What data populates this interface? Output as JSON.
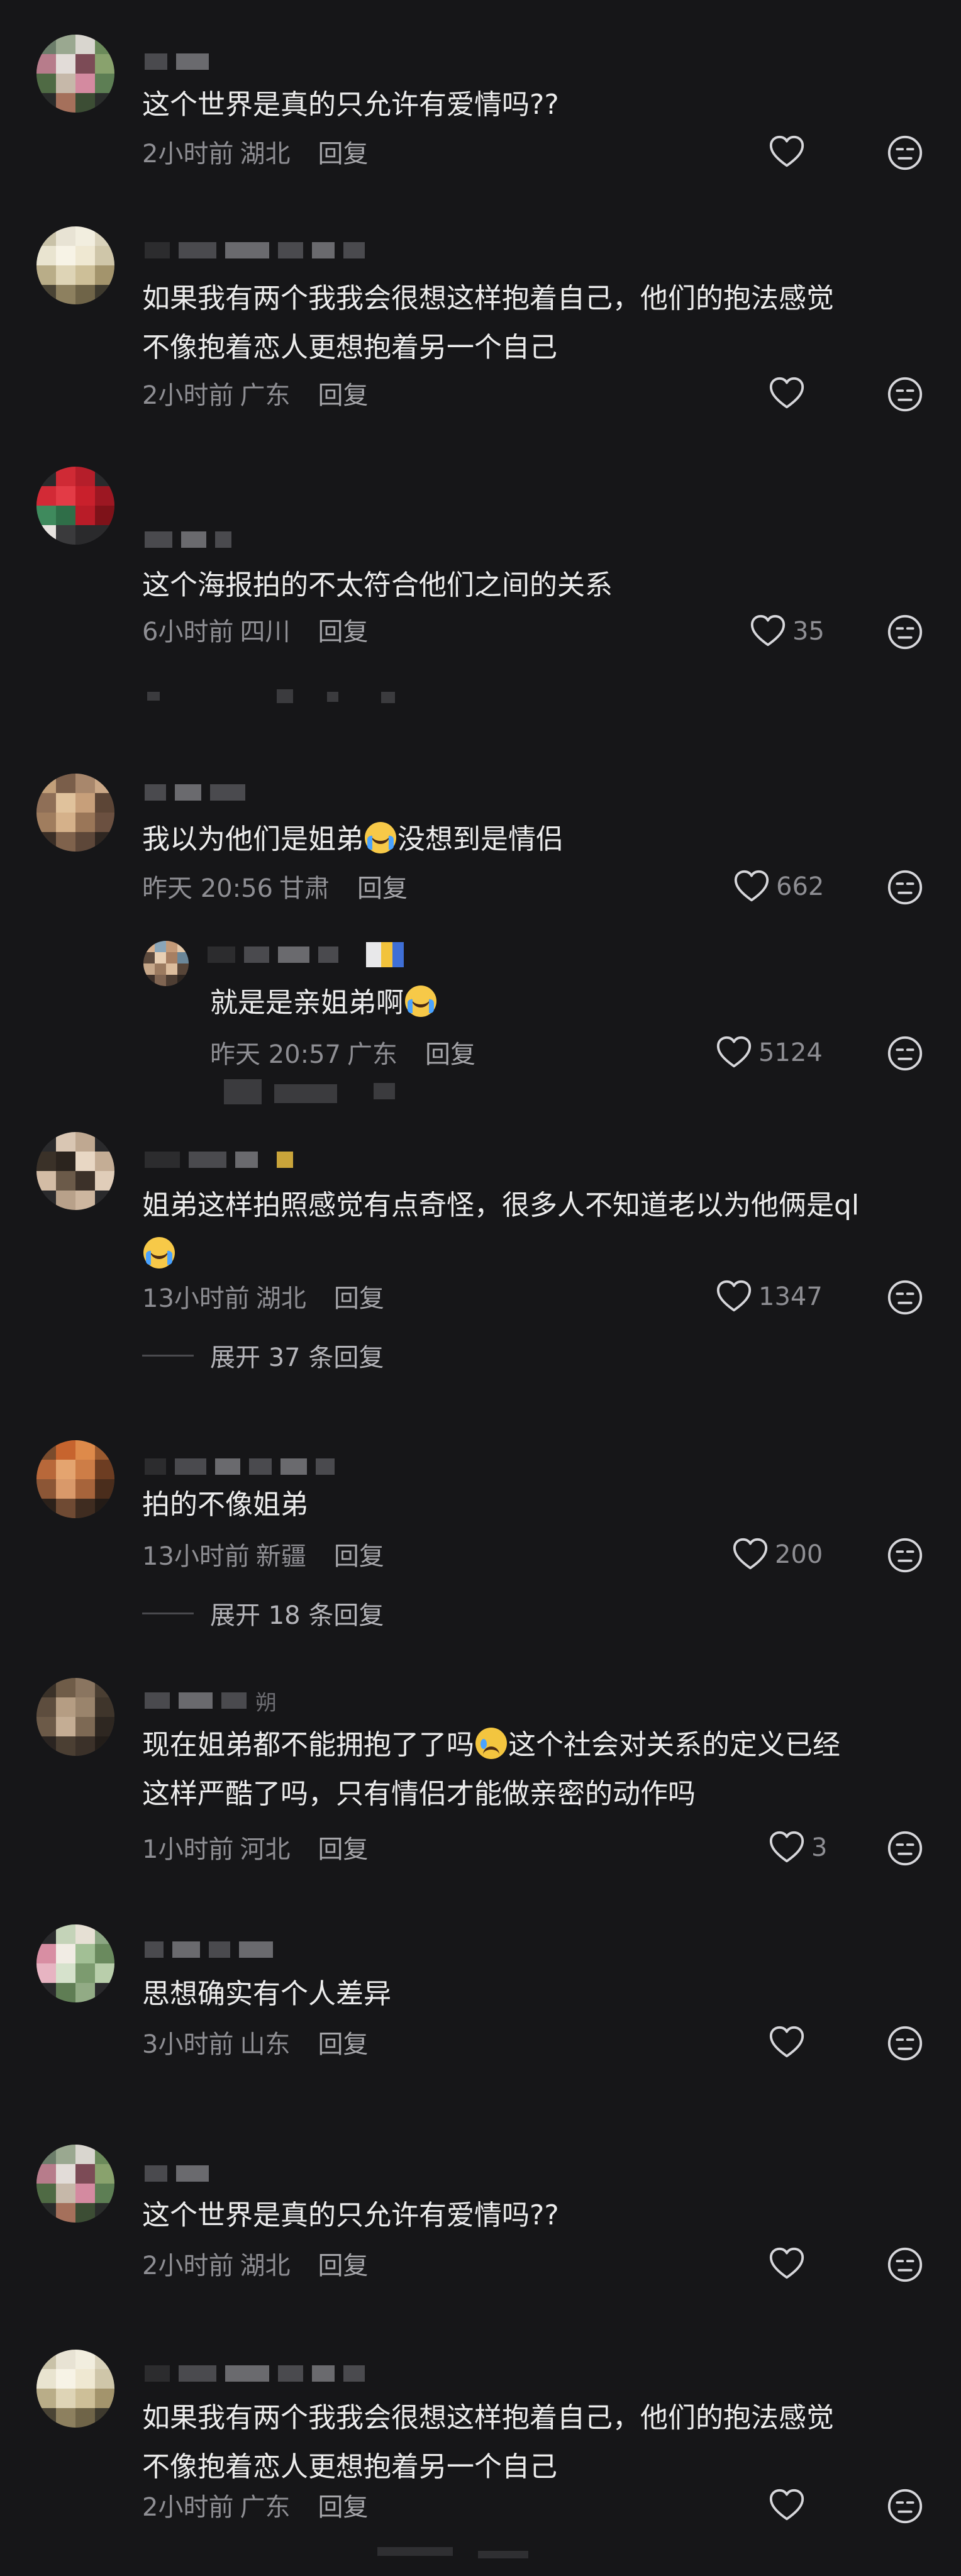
{
  "comments": [
    {
      "text": "这个世界是真的只允许有爱情吗??",
      "time": "2小时前",
      "location": "湖北",
      "reply": "回复",
      "likes": ""
    },
    {
      "text": "如果我有两个我我会很想这样抱着自己，他们的抱法感觉\n不像抱着恋人更想抱着另一个自己",
      "time": "2小时前",
      "location": "广东",
      "reply": "回复",
      "likes": ""
    },
    {
      "text": "这个海报拍的不太符合他们之间的关系",
      "time": "6小时前",
      "location": "四川",
      "reply": "回复",
      "likes": "35"
    },
    {
      "text_a": "我以为他们是姐弟",
      "text_b": "没想到是情侣",
      "time": "昨天 20:56",
      "location": "甘肃",
      "reply": "回复",
      "likes": "662",
      "sub_reply": {
        "text": "就是是亲姐弟啊",
        "time": "昨天 20:57",
        "location": "广东",
        "reply": "回复",
        "likes": "5124"
      }
    },
    {
      "text": "姐弟这样拍照感觉有点奇怪，很多人不知道老以为他俩是ql",
      "time": "13小时前",
      "location": "湖北",
      "reply": "回复",
      "likes": "1347",
      "expand": "展开 37 条回复"
    },
    {
      "text": "拍的不像姐弟",
      "time": "13小时前",
      "location": "新疆",
      "reply": "回复",
      "likes": "200",
      "expand": "展开 18 条回复"
    },
    {
      "text_a": "现在姐弟都不能拥抱了了吗",
      "text_b": "这个社会对关系的定义已经\n这样严酷了吗，只有情侣才能做亲密的动作吗",
      "username_tail": "朔",
      "time": "1小时前",
      "location": "河北",
      "reply": "回复",
      "likes": "3"
    },
    {
      "text": "思想确实有个人差异",
      "time": "3小时前",
      "location": "山东",
      "reply": "回复",
      "likes": ""
    },
    {
      "text": "这个世界是真的只允许有爱情吗??",
      "time": "2小时前",
      "location": "湖北",
      "reply": "回复",
      "likes": ""
    },
    {
      "text": "如果我有两个我我会很想这样抱着自己，他们的抱法感觉\n不像抱着恋人更想抱着另一个自己",
      "time": "2小时前",
      "location": "广东",
      "reply": "回复",
      "likes": ""
    }
  ],
  "icons": {
    "like": "heart-icon",
    "dislike": "dislike-face-icon",
    "emoji_1": "crying-emoji",
    "emoji_2": "sad-tear-emoji"
  },
  "colors": {
    "background": "#161618",
    "text": "#ececec",
    "muted": "#8e8e93"
  }
}
